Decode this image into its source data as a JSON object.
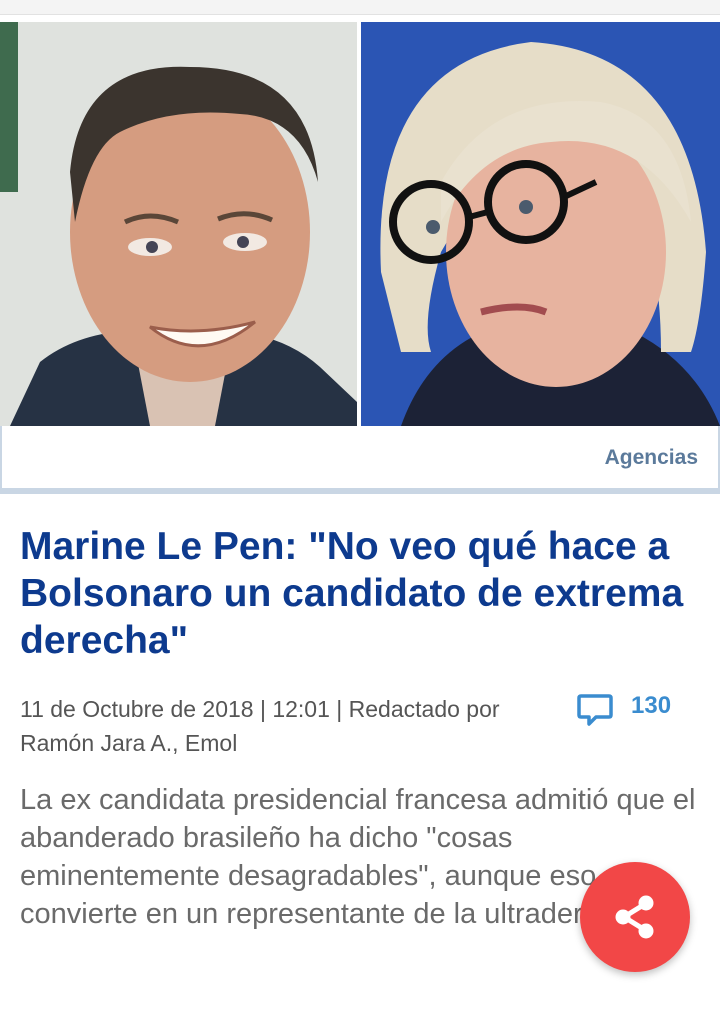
{
  "article": {
    "image_credit": "Agencias",
    "headline": "Marine Le Pen: \"No veo qué hace a Bolsonaro un candidato de extrema derecha\"",
    "meta": {
      "byline": "11 de Octubre de 2018 | 12:01 | Redactado por Ramón Jara A., Emol"
    },
    "comments": {
      "icon": "comment-icon",
      "count": "130"
    },
    "summary": "La ex candidata presidencial francesa admitió que el abanderado brasileño ha dicho \"cosas eminentemente desagradables\", aunque eso no lo convierte en un representante de la ultraderecha."
  },
  "share_button": {
    "icon": "share-icon"
  },
  "colors": {
    "headline": "#0d3a8e",
    "credit": "#5b7a9b",
    "accent_blue": "#3a8ccf",
    "fab": "#f24747",
    "separator": "#c9d6e4"
  }
}
